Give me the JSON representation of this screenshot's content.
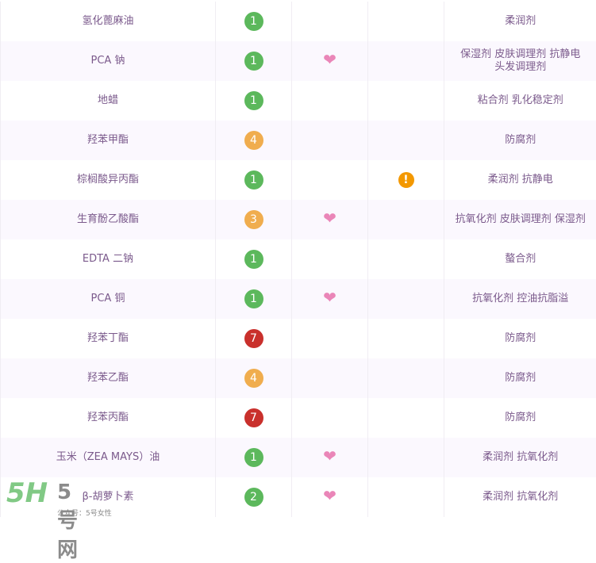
{
  "colors": {
    "1": "#5cb85c",
    "2": "#5cb85c",
    "3": "#f0ad4e",
    "4": "#f0ad4e",
    "7": "#c9302c"
  },
  "rows": [
    {
      "name": "氢化蓖麻油",
      "score": "1",
      "heart": false,
      "alert": false,
      "func": "柔润剂"
    },
    {
      "name": "PCA 钠",
      "score": "1",
      "heart": true,
      "alert": false,
      "func": "保湿剂 皮肤调理剂 抗静电 头发调理剂"
    },
    {
      "name": "地蜡",
      "score": "1",
      "heart": false,
      "alert": false,
      "func": "粘合剂 乳化稳定剂"
    },
    {
      "name": "羟苯甲酯",
      "score": "4",
      "heart": false,
      "alert": false,
      "func": "防腐剂"
    },
    {
      "name": "棕榈酸异丙酯",
      "score": "1",
      "heart": false,
      "alert": true,
      "func": "柔润剂 抗静电"
    },
    {
      "name": "生育酚乙酸酯",
      "score": "3",
      "heart": true,
      "alert": false,
      "func": "抗氧化剂 皮肤调理剂 保湿剂"
    },
    {
      "name": "EDTA 二钠",
      "score": "1",
      "heart": false,
      "alert": false,
      "func": "螯合剂"
    },
    {
      "name": "PCA 铜",
      "score": "1",
      "heart": true,
      "alert": false,
      "func": "抗氧化剂 控油抗脂溢"
    },
    {
      "name": "羟苯丁酯",
      "score": "7",
      "heart": false,
      "alert": false,
      "func": "防腐剂"
    },
    {
      "name": "羟苯乙酯",
      "score": "4",
      "heart": false,
      "alert": false,
      "func": "防腐剂"
    },
    {
      "name": "羟苯丙酯",
      "score": "7",
      "heart": false,
      "alert": false,
      "func": "防腐剂"
    },
    {
      "name": "玉米（ZEA MAYS）油",
      "score": "1",
      "heart": true,
      "alert": false,
      "func": "柔润剂 抗氧化剂"
    },
    {
      "name": "β-胡萝卜素",
      "score": "2",
      "heart": true,
      "alert": false,
      "func": "柔润剂 抗氧化剂"
    }
  ],
  "icons": {
    "heart": "heart-icon",
    "alert": "exclamation-icon"
  },
  "watermark": {
    "logo": "5H",
    "name": "5号网",
    "sub": "公众号：5号女性"
  }
}
